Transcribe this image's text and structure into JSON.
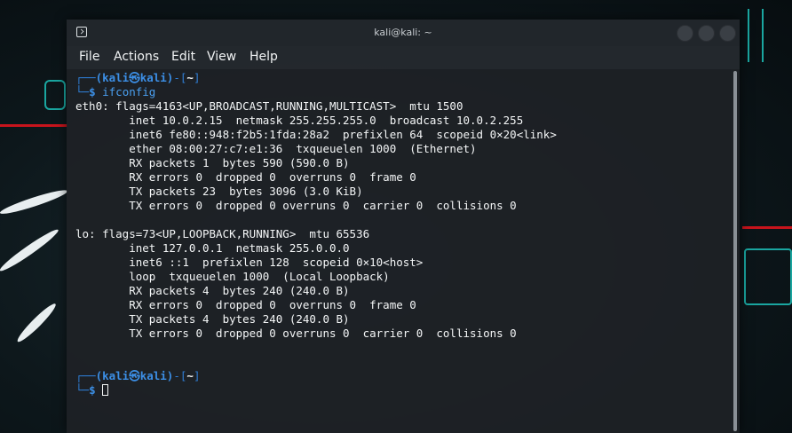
{
  "window": {
    "title": "kali@kali: ~"
  },
  "menu": [
    "File",
    "Actions",
    "Edit",
    "View",
    "Help"
  ],
  "prompt": {
    "corner_top": "┌──",
    "user": "(kali㉿kali)",
    "dir_open": "-[",
    "dir": "~",
    "dir_close": "]",
    "corner_bottom": "└─",
    "dollar": "$"
  },
  "command": "ifconfig",
  "output": [
    "eth0: flags=4163<UP,BROADCAST,RUNNING,MULTICAST>  mtu 1500",
    "        inet 10.0.2.15  netmask 255.255.255.0  broadcast 10.0.2.255",
    "        inet6 fe80::948:f2b5:1fda:28a2  prefixlen 64  scopeid 0×20<link>",
    "        ether 08:00:27:c7:e1:36  txqueuelen 1000  (Ethernet)",
    "        RX packets 1  bytes 590 (590.0 B)",
    "        RX errors 0  dropped 0  overruns 0  frame 0",
    "        TX packets 23  bytes 3096 (3.0 KiB)",
    "        TX errors 0  dropped 0 overruns 0  carrier 0  collisions 0",
    "",
    "lo: flags=73<UP,LOOPBACK,RUNNING>  mtu 65536",
    "        inet 127.0.0.1  netmask 255.0.0.0",
    "        inet6 ::1  prefixlen 128  scopeid 0×10<host>",
    "        loop  txqueuelen 1000  (Local Loopback)",
    "        RX packets 4  bytes 240 (240.0 B)",
    "        RX errors 0  dropped 0  overruns 0  frame 0",
    "        TX packets 4  bytes 240 (240.0 B)",
    "        TX errors 0  dropped 0 overruns 0  carrier 0  collisions 0"
  ],
  "colors": {
    "prompt_blue": "#3c8fe6",
    "terminal_bg": "#1e2126",
    "text": "#f4f6f7"
  },
  "icons": {
    "app": "terminal-icon",
    "window_buttons": [
      "minimize-icon",
      "maximize-icon",
      "close-icon"
    ]
  }
}
